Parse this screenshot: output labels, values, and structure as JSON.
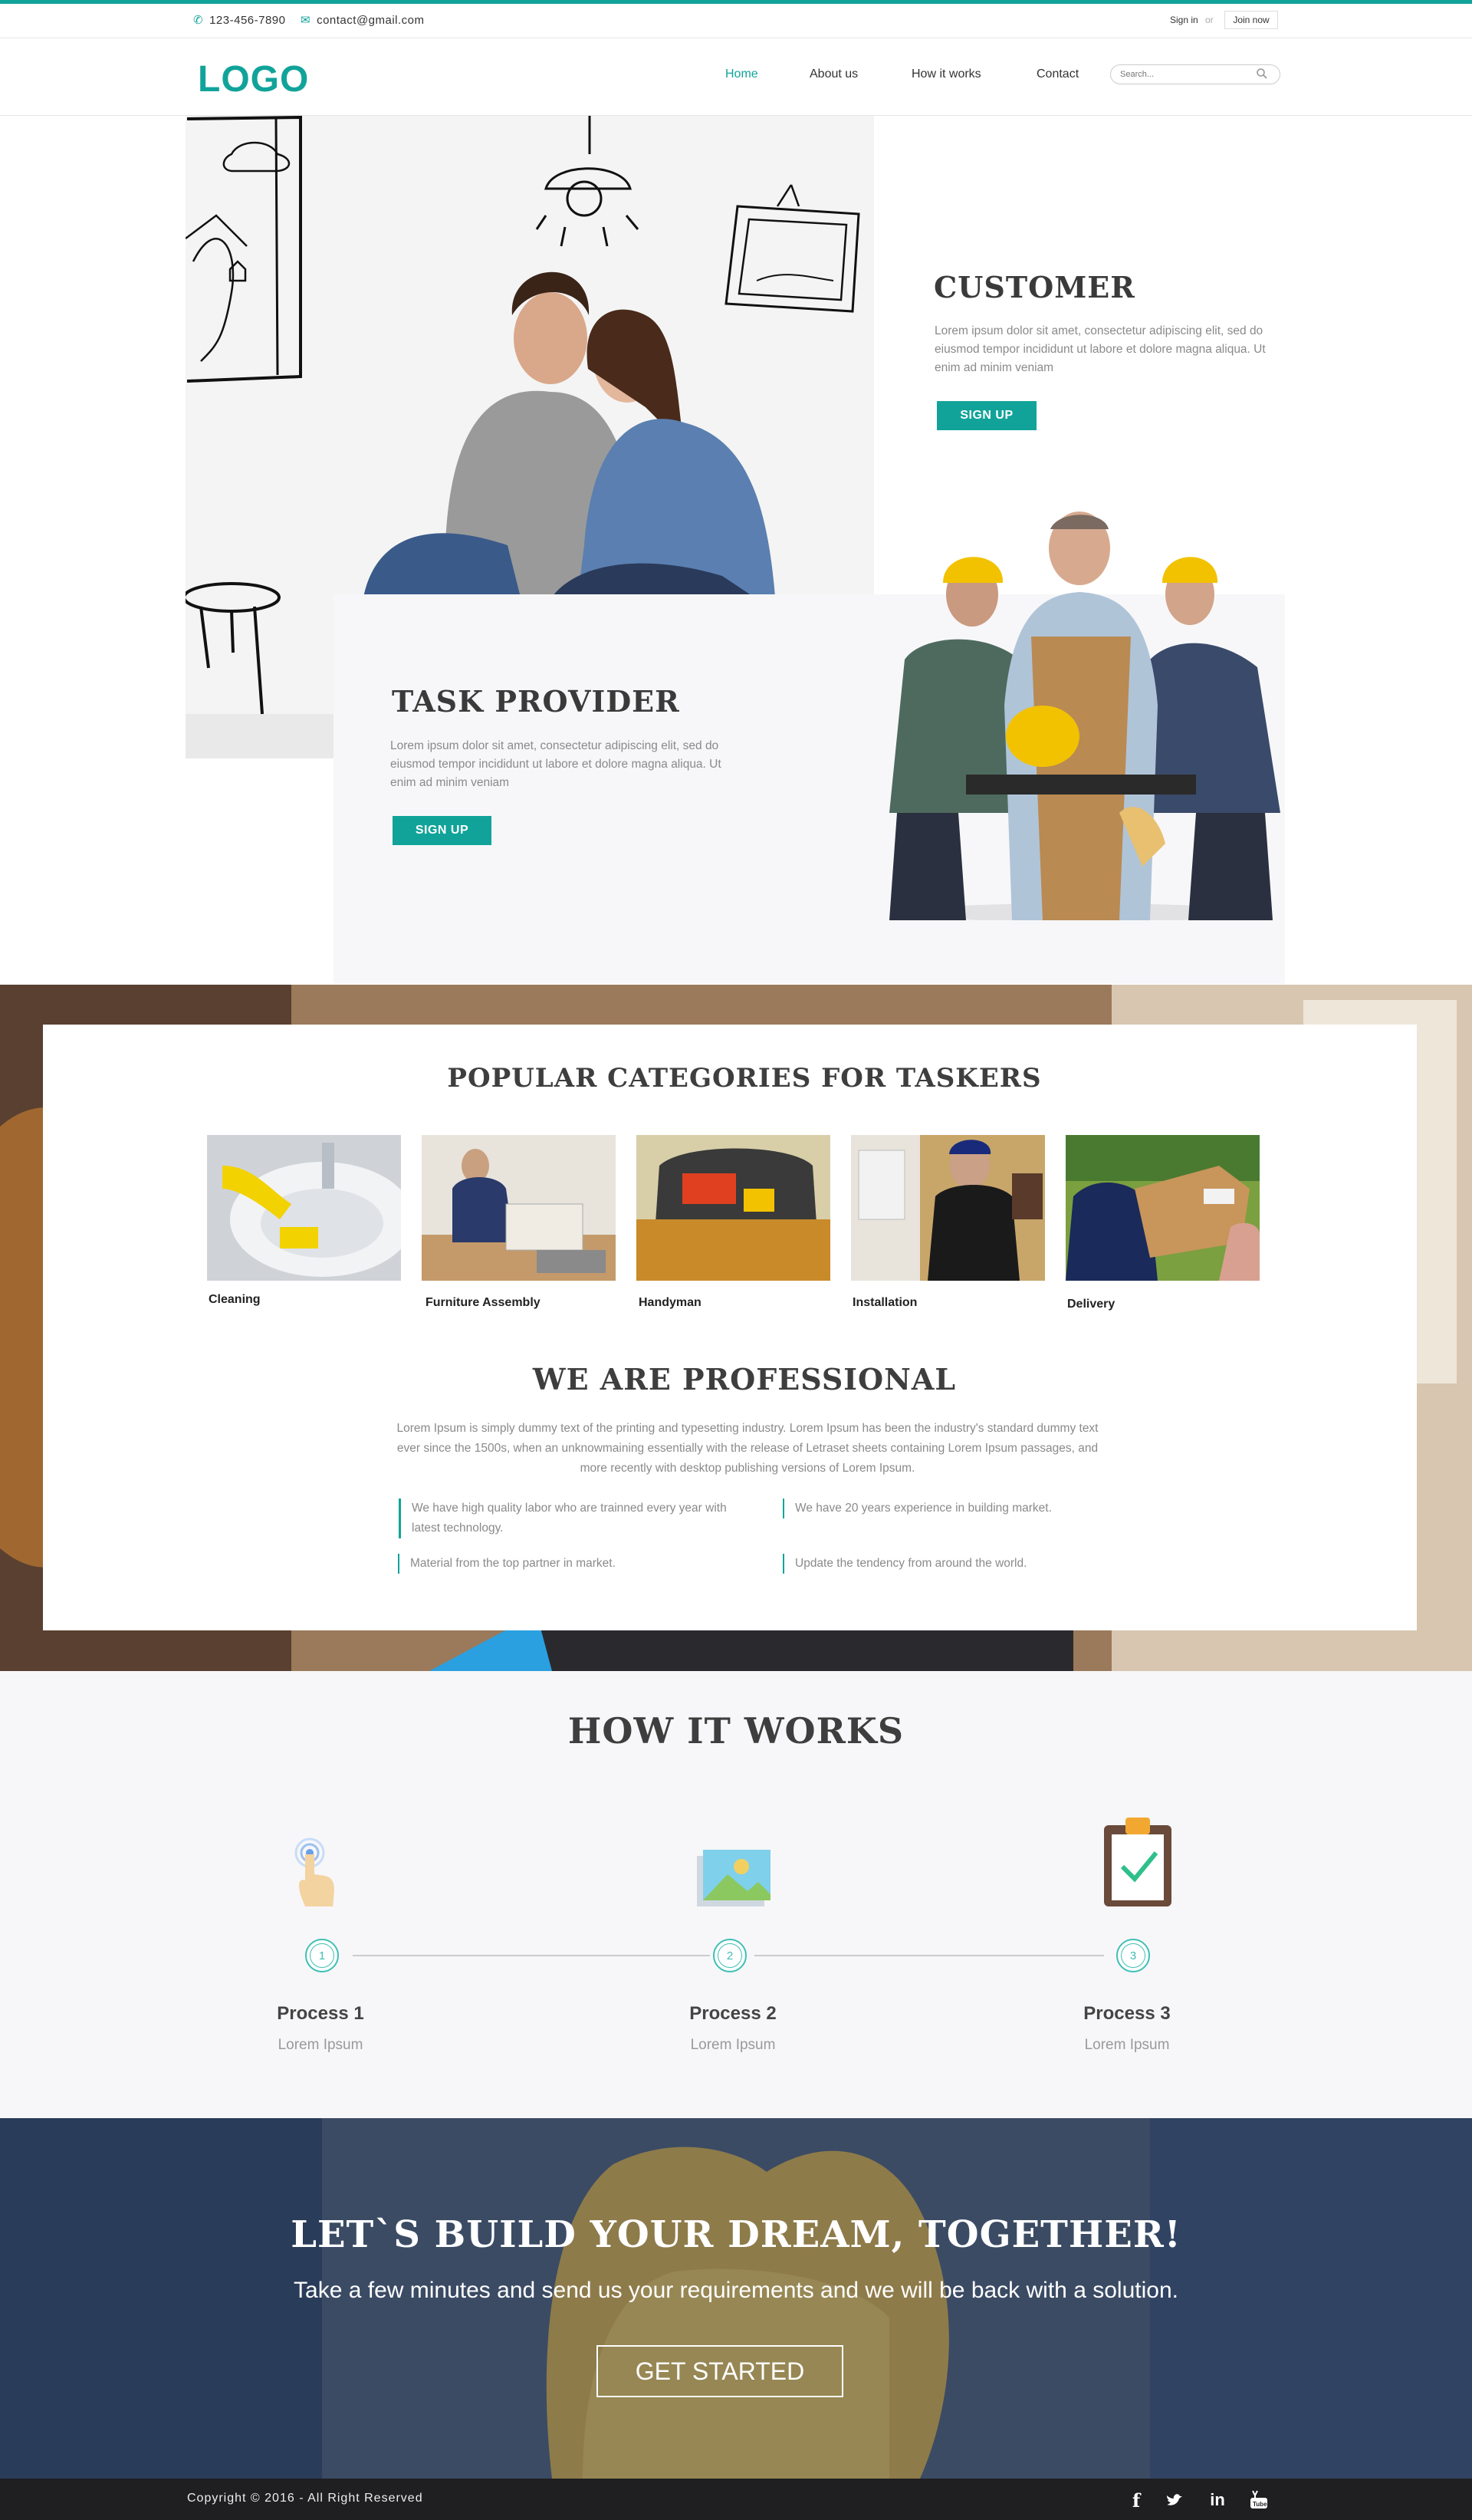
{
  "topbar": {
    "phone": "123-456-7890",
    "email": "contact@gmail.com",
    "signin": "Sign in",
    "or": "or",
    "joinnow": "Join now"
  },
  "nav": {
    "logo": "LOGO",
    "links": [
      "Home",
      "About us",
      "How it works",
      "Contact"
    ],
    "search_placeholder": "Search..."
  },
  "customer": {
    "title": "CUSTOMER",
    "text": "Lorem ipsum dolor sit amet, consectetur adipiscing elit, sed do eiusmod tempor incididunt ut labore et dolore magna aliqua. Ut enim ad minim veniam",
    "button": "SIGN UP"
  },
  "provider": {
    "title": "TASK PROVIDER",
    "text": "Lorem ipsum dolor sit amet, consectetur adipiscing elit, sed do eiusmod tempor incididunt ut labore et dolore magna aliqua. Ut enim ad minim veniam",
    "button": "SIGN UP"
  },
  "categories": {
    "title": "POPULAR CATEGORIES FOR TASKERS",
    "items": [
      "Cleaning",
      "Furniture Assembly",
      "Handyman",
      "Installation",
      "Delivery"
    ]
  },
  "professional": {
    "title": "WE ARE PROFESSIONAL",
    "text": "Lorem Ipsum is simply dummy text of the printing and typesetting industry. Lorem Ipsum has been the industry's standard dummy text ever since the 1500s, when an unknowmaining essentially with the release of Letraset sheets containing Lorem Ipsum passages, and more recently with desktop publishing versions of Lorem Ipsum.",
    "bullets": [
      "We have high quality labor who are trainned every year with latest technology.",
      "We have 20 years experience in building market.",
      "Material from the top partner in market.",
      "Update the tendency from around the world."
    ]
  },
  "how": {
    "title": "HOW IT WORKS",
    "steps": [
      {
        "num": "1",
        "title": "Process 1",
        "sub": "Lorem Ipsum"
      },
      {
        "num": "2",
        "title": "Process 2",
        "sub": "Lorem Ipsum"
      },
      {
        "num": "3",
        "title": "Process 3",
        "sub": "Lorem Ipsum"
      }
    ]
  },
  "cta": {
    "title": "LET`S BUILD YOUR DREAM, TOGETHER!",
    "text": "Take a few minutes and send us your requirements and we will be back with a solution.",
    "button": "GET STARTED"
  },
  "footer": {
    "copyright": "Copyright © 2016 - All Right Reserved",
    "social": [
      "facebook-icon",
      "twitter-icon",
      "linkedin-icon",
      "youtube-icon"
    ],
    "social_glyphs": [
      "f",
      "",
      "in",
      ""
    ]
  },
  "colors": {
    "accent": "#11a39a",
    "footer": "#1f1f21",
    "heading": "#3e3e3e"
  }
}
